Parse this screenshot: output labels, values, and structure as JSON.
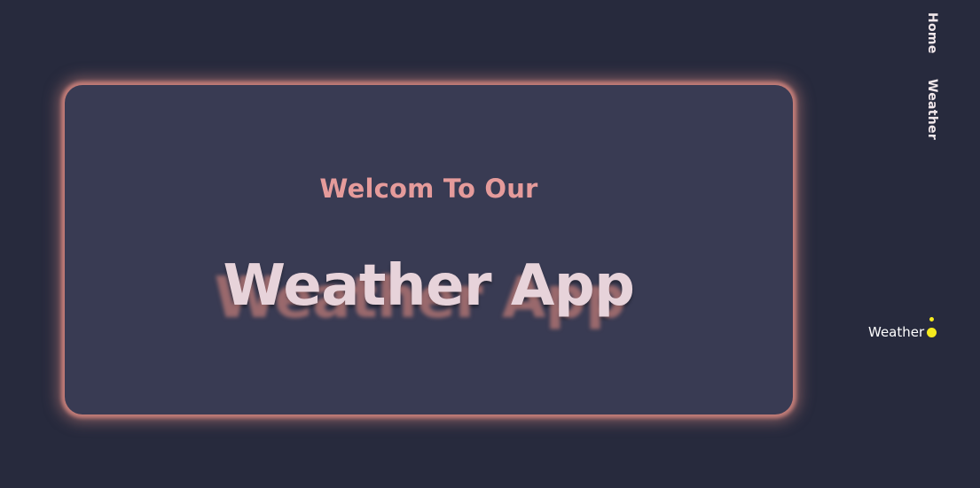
{
  "nav": {
    "items": [
      {
        "label": "Home"
      },
      {
        "label": "Weather"
      }
    ]
  },
  "hero": {
    "subtitle": "Welcom To Our",
    "title": "Weather App"
  },
  "status": {
    "label": "Weather",
    "dot_color": "#f5ea1e"
  },
  "colors": {
    "background": "#272a3d",
    "card": "#393b53",
    "glow": "#c37d78",
    "subtitle": "#e59b9b",
    "title": "#e7d3da"
  }
}
